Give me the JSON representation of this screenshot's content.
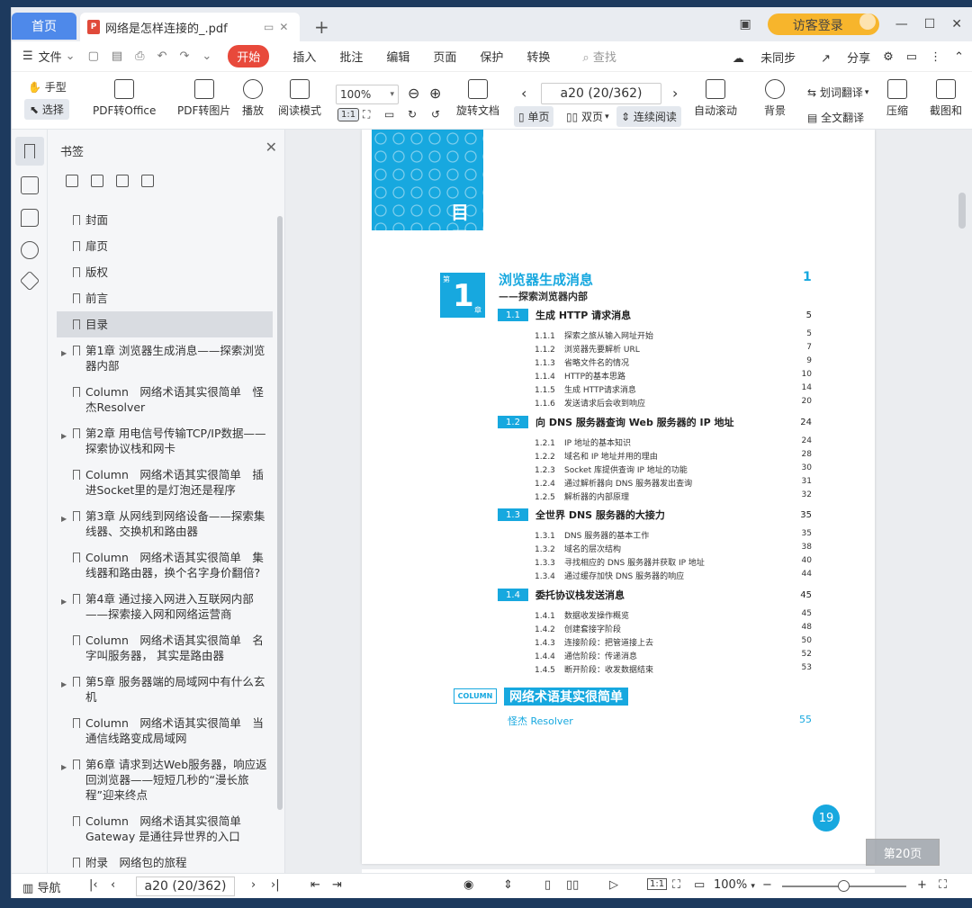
{
  "tabs": {
    "home": "首页",
    "document": "网络是怎样连接的_.pdf"
  },
  "window": {
    "login": "访客登录"
  },
  "menu": {
    "file": "文件",
    "items": [
      "开始",
      "插入",
      "批注",
      "编辑",
      "页面",
      "保护",
      "转换"
    ],
    "search_placeholder": "查找",
    "sync": "未同步",
    "share": "分享"
  },
  "toolbar": {
    "hand": "手型",
    "select": "选择",
    "pdf_to_office": "PDF转Office",
    "pdf_to_image": "PDF转图片",
    "play": "播放",
    "read_mode": "阅读模式",
    "zoom": "100%",
    "rotate_doc": "旋转文档",
    "page_value": "a20 (20/362)",
    "single_page": "单页",
    "double_page": "双页",
    "continuous": "连续阅读",
    "auto_scroll": "自动滚动",
    "background": "背景",
    "word_translate": "划词翻译",
    "full_translate": "全文翻译",
    "compress": "压缩",
    "screenshot": "截图和"
  },
  "bookmarks": {
    "title": "书签",
    "items": [
      {
        "label": "封面"
      },
      {
        "label": "扉页"
      },
      {
        "label": "版权"
      },
      {
        "label": "前言"
      },
      {
        "label": "目录"
      },
      {
        "label": "第1章 浏览器生成消息——探索浏览器内部"
      },
      {
        "label": "Column　网络术语其实很简单　怪杰Resolver"
      },
      {
        "label": "第2章 用电信号传输TCP/IP数据——探索协议栈和网卡"
      },
      {
        "label": "Column　网络术语其实很简单　插进Socket里的是灯泡还是程序"
      },
      {
        "label": "第3章 从网线到网络设备——探索集线器、交换机和路由器"
      },
      {
        "label": "Column　网络术语其实很简单　集线器和路由器，换个名字身价翻倍?"
      },
      {
        "label": "第4章 通过接入网进入互联网内部——探索接入网和网络运营商"
      },
      {
        "label": "Column　网络术语其实很简单　名字叫服务器， 其实是路由器"
      },
      {
        "label": "第5章 服务器端的局域网中有什么玄机"
      },
      {
        "label": "Column　网络术语其实很简单　当通信线路变成局域网"
      },
      {
        "label": "第6章 请求到达Web服务器，响应返回浏览器——短短几秒的“漫长旅程”迎来终点"
      },
      {
        "label": "Column　网络术语其实很简单　Gateway 是通往异世界的入口"
      },
      {
        "label": "附录　网络包的旅程"
      }
    ]
  },
  "page": {
    "banner": "目录",
    "chapter": {
      "badge_num": "1",
      "badge_top": "第",
      "badge_bottom": "章",
      "title": "浏览器生成消息",
      "subtitle": "——探索浏览器内部",
      "page": "1"
    },
    "sections": [
      {
        "num": "1.1",
        "title": "生成 HTTP 请求消息",
        "page": "5",
        "subs": [
          {
            "num": "1.1.1",
            "title": "探索之旅从输入网址开始",
            "page": "5"
          },
          {
            "num": "1.1.2",
            "title": "浏览器先要解析 URL",
            "page": "7"
          },
          {
            "num": "1.1.3",
            "title": "省略文件名的情况",
            "page": "9"
          },
          {
            "num": "1.1.4",
            "title": "HTTP的基本思路",
            "page": "10"
          },
          {
            "num": "1.1.5",
            "title": "生成 HTTP请求消息",
            "page": "14"
          },
          {
            "num": "1.1.6",
            "title": "发送请求后会收到响应",
            "page": "20"
          }
        ]
      },
      {
        "num": "1.2",
        "title": "向 DNS 服务器查询 Web 服务器的 IP 地址",
        "page": "24",
        "subs": [
          {
            "num": "1.2.1",
            "title": "IP 地址的基本知识",
            "page": "24"
          },
          {
            "num": "1.2.2",
            "title": "域名和 IP 地址并用的理由",
            "page": "28"
          },
          {
            "num": "1.2.3",
            "title": "Socket 库提供查询 IP 地址的功能",
            "page": "30"
          },
          {
            "num": "1.2.4",
            "title": "通过解析器向 DNS 服务器发出查询",
            "page": "31"
          },
          {
            "num": "1.2.5",
            "title": "解析器的内部原理",
            "page": "32"
          }
        ]
      },
      {
        "num": "1.3",
        "title": "全世界 DNS 服务器的大接力",
        "page": "35",
        "subs": [
          {
            "num": "1.3.1",
            "title": "DNS 服务器的基本工作",
            "page": "35"
          },
          {
            "num": "1.3.2",
            "title": "域名的层次结构",
            "page": "38"
          },
          {
            "num": "1.3.3",
            "title": "寻找相应的 DNS 服务器并获取 IP 地址",
            "page": "40"
          },
          {
            "num": "1.3.4",
            "title": "通过缓存加快 DNS 服务器的响应",
            "page": "44"
          }
        ]
      },
      {
        "num": "1.4",
        "title": "委托协议栈发送消息",
        "page": "45",
        "subs": [
          {
            "num": "1.4.1",
            "title": "数据收发操作概览",
            "page": "45"
          },
          {
            "num": "1.4.2",
            "title": "创建套接字阶段",
            "page": "48"
          },
          {
            "num": "1.4.3",
            "title": "连接阶段：把管道接上去",
            "page": "50"
          },
          {
            "num": "1.4.4",
            "title": "通信阶段：传递消息",
            "page": "52"
          },
          {
            "num": "1.4.5",
            "title": "断开阶段：收发数据结束",
            "page": "53"
          }
        ]
      }
    ],
    "column": {
      "badge": "COLUMN",
      "title": "网络术语其实很简单",
      "subtitle": "怪杰 Resolver",
      "page": "55"
    },
    "page_number": "19",
    "float_page": "第20页"
  },
  "statusbar": {
    "nav": "导航",
    "page_value": "a20 (20/362)",
    "zoom": "100%"
  }
}
